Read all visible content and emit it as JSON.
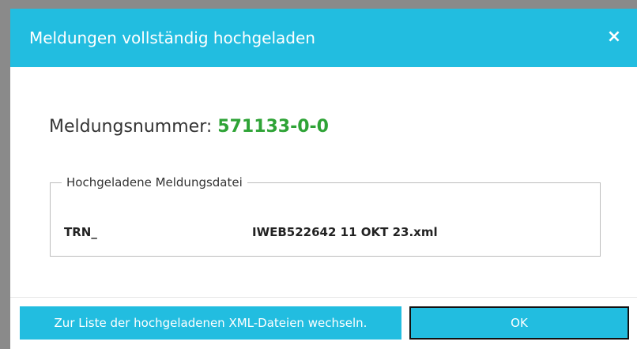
{
  "dialog": {
    "title": "Meldungen vollständig hochgeladen",
    "close_icon": "×",
    "message_label": "Meldungsnummer:",
    "message_number": "571133-0-0",
    "fieldset_legend": "Hochgeladene Meldungsdatei",
    "file_prefix": "TRN_",
    "file_rest": "IWEB522642 11 OKT 23.xml",
    "list_button_label": "Zur Liste der hochgeladenen XML-Dateien wechseln.",
    "ok_button_label": "OK"
  },
  "colors": {
    "accent": "#22bde0",
    "number_green": "#2ea336",
    "background": "#8a8a8a"
  }
}
